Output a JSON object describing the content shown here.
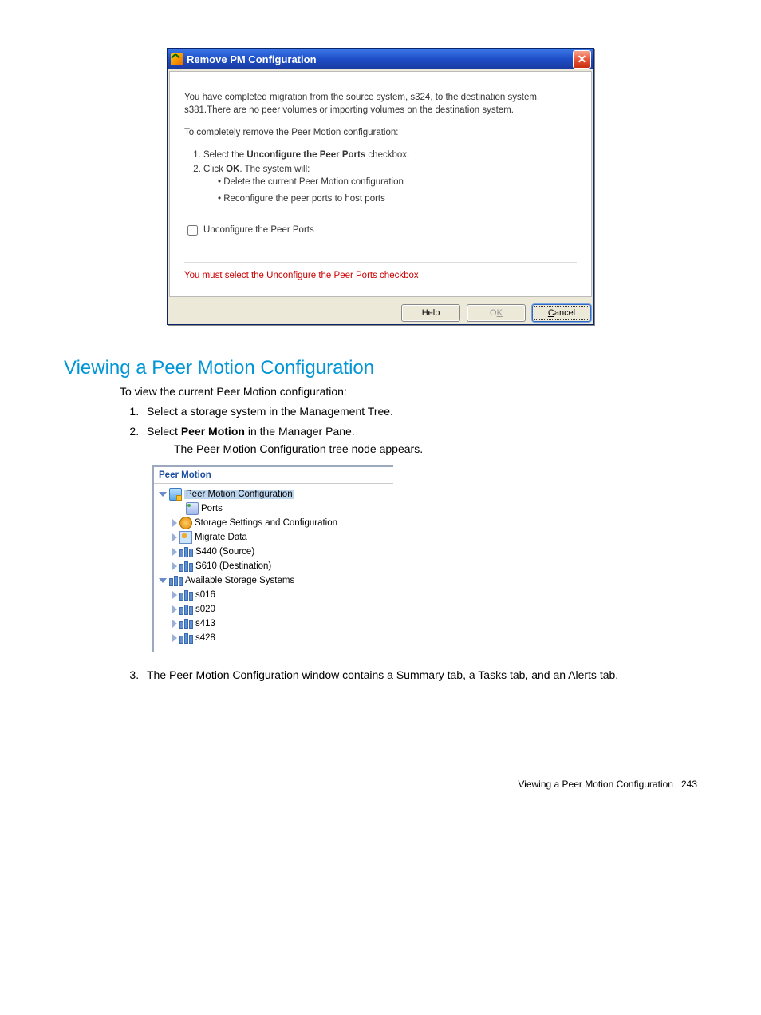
{
  "dialog": {
    "title": "Remove PM Configuration",
    "body_p1": "You have completed migration from the source system, s324, to the destination system, s381.There are no peer volumes or importing volumes on the destination system.",
    "body_p2": "To completely remove the Peer Motion configuration:",
    "step1_prefix": "Select the ",
    "step1_bold": "Unconfigure the Peer Ports",
    "step1_suffix": " checkbox.",
    "step2_prefix": "Click ",
    "step2_bold": "OK",
    "step2_suffix": ". The system will:",
    "bullet1": "Delete the current Peer Motion configuration",
    "bullet2": "Reconfigure the peer ports to host ports",
    "checkbox_label": "Unconfigure the Peer Ports",
    "error": "You must select the Unconfigure the Peer Ports checkbox",
    "btn_help": "Help",
    "btn_ok": "OK",
    "btn_cancel": "Cancel"
  },
  "section": {
    "heading": "Viewing a Peer Motion Configuration",
    "intro": "To view the current Peer Motion configuration:",
    "step1": "Select a storage system in the Management Tree.",
    "step2_prefix": "Select ",
    "step2_bold": "Peer Motion",
    "step2_suffix": " in the Manager Pane.",
    "step2_line2": "The Peer Motion Configuration tree node appears.",
    "step3": "The Peer Motion Configuration window contains a Summary tab, a Tasks tab, and an Alerts tab."
  },
  "tree": {
    "title": "Peer Motion",
    "root": "Peer Motion Configuration",
    "ports": "Ports",
    "storage_settings": "Storage Settings and Configuration",
    "migrate": "Migrate Data",
    "source": "S440 (Source)",
    "dest": "S610 (Destination)",
    "available": "Available Storage Systems",
    "s1": "s016",
    "s2": "s020",
    "s3": "s413",
    "s4": "s428"
  },
  "footer": {
    "text": "Viewing a Peer Motion Configuration",
    "page": "243"
  }
}
